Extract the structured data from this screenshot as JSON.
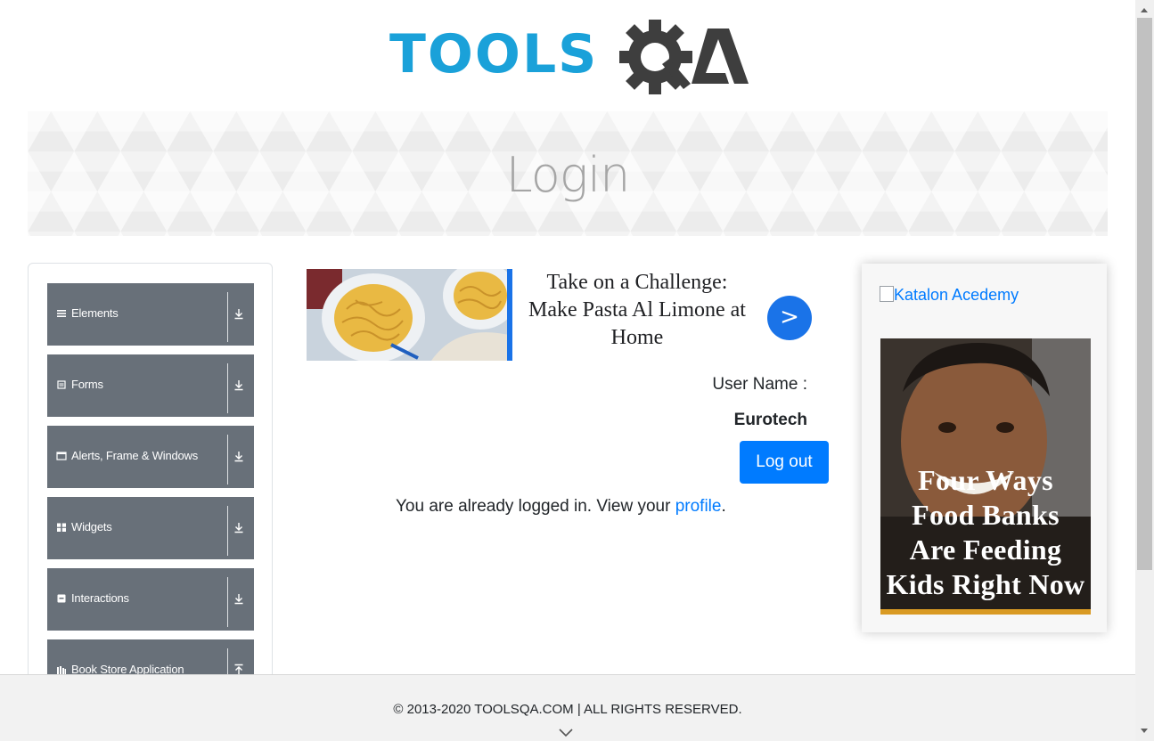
{
  "header": {
    "logo_tools": "TOOLS",
    "logo_q": "Q",
    "logo_a": "A"
  },
  "banner": {
    "title": "Login"
  },
  "sidebar": {
    "groups": [
      {
        "label": "Elements",
        "icon": "list-icon"
      },
      {
        "label": "Forms",
        "icon": "form-icon"
      },
      {
        "label": "Alerts, Frame & Windows",
        "icon": "window-icon"
      },
      {
        "label": "Widgets",
        "icon": "widgets-icon"
      },
      {
        "label": "Interactions",
        "icon": "interactions-icon"
      },
      {
        "label": "Book Store Application",
        "icon": "book-icon"
      }
    ]
  },
  "ad_center": {
    "headline_line1": "Take on a Challenge:",
    "headline_line2": "Make Pasta Al Limone at",
    "headline_line3": "Home",
    "button_label": ">"
  },
  "profile": {
    "username_label": "User Name :",
    "username_value": "Eurotech",
    "logout_label": "Log out",
    "already_text": "You are already logged in. View your",
    "profile_link": "profile",
    "already_end": "."
  },
  "ad_right": {
    "katalon_alt": "Katalon Acedemy",
    "kids_line1": "Four Ways",
    "kids_line2": "Food Banks",
    "kids_line3": "Are Feeding",
    "kids_line4": "Kids Right Now"
  },
  "footer": {
    "copyright": "© 2013-2020 TOOLSQA.COM | ALL RIGHTS RESERVED."
  },
  "colors": {
    "brand_blue": "#1aa1d9",
    "logo_dark": "#3e3e3e",
    "primary": "#007bff",
    "sidebar_group": "#687079",
    "ad_blue": "#1a73e8"
  }
}
